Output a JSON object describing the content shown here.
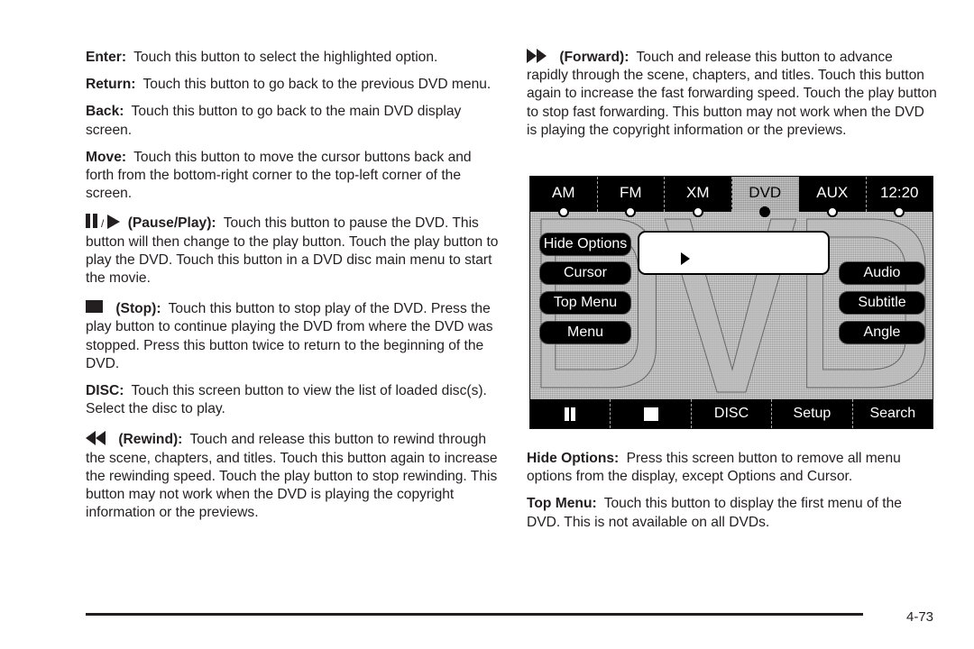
{
  "left_column": [
    {
      "term": "Enter:",
      "text": "Touch this button to select the highlighted option."
    },
    {
      "term": "Return:",
      "text": "Touch this button to go back to the previous DVD menu."
    },
    {
      "term": "Back:",
      "text": "Touch this button to go back to the main DVD display screen."
    },
    {
      "term": "Move:",
      "text": "Touch this button to move the cursor buttons back and forth from the bottom-right corner to the top-left corner of the screen."
    },
    {
      "icon": "pause-play-icon",
      "slash": "/",
      "term": "(Pause/Play):",
      "text": "Touch this button to pause the DVD. This button will then change to the play button. Touch the play button to play the DVD. Touch this button in a DVD disc main menu to start the movie."
    },
    {
      "icon": "stop-icon",
      "term": "(Stop):",
      "text": "Touch this button to stop play of the DVD. Press the play button to continue playing the DVD from where the DVD was stopped. Press this button twice to return to the beginning of the DVD."
    },
    {
      "term": "DISC:",
      "text": "Touch this screen button to view the list of loaded disc(s). Select the disc to play."
    },
    {
      "icon": "rewind-icon",
      "term": "(Rewind):",
      "text": "Touch and release this button to rewind through the scene, chapters, and titles. Touch this button again to increase the rewinding speed. Touch the play button to stop rewinding. This button may not work when the DVD is playing the copyright information or the previews."
    }
  ],
  "right_column": [
    {
      "icon": "fast-forward-icon",
      "term": "(Forward):",
      "text": "Touch and release this button to advance rapidly through the scene, chapters, and titles. Touch this button again to increase the fast forwarding speed. Touch the play button to stop fast forwarding. This button may not work when the DVD is playing the copyright information or the previews."
    },
    {
      "term": "Hide Options:",
      "text": "Press this screen button to remove all menu options from the display, except Options and Cursor."
    },
    {
      "term": "Top Menu:",
      "text": "Touch this button to display the first menu of the DVD. This is not available on all DVDs."
    }
  ],
  "dvd_screen": {
    "source_tabs": [
      {
        "label": "AM",
        "active": false
      },
      {
        "label": "FM",
        "active": false
      },
      {
        "label": "XM",
        "active": false
      },
      {
        "label": "DVD",
        "active": true
      },
      {
        "label": "AUX",
        "active": false
      },
      {
        "label": "12:20",
        "active": false
      }
    ],
    "background_watermark": "DVD",
    "left_buttons": [
      "Hide Options",
      "Cursor",
      "Top Menu",
      "Menu"
    ],
    "right_buttons": [
      "Audio",
      "Subtitle",
      "Angle"
    ],
    "video_box_icon": "play-cursor-icon",
    "bottom_buttons": [
      {
        "label": "",
        "icon": "pause-icon"
      },
      {
        "label": "",
        "icon": "stop-icon"
      },
      {
        "label": "DISC"
      },
      {
        "label": "Setup"
      },
      {
        "label": "Search"
      }
    ]
  },
  "footer": {
    "page_number": "4-73"
  }
}
